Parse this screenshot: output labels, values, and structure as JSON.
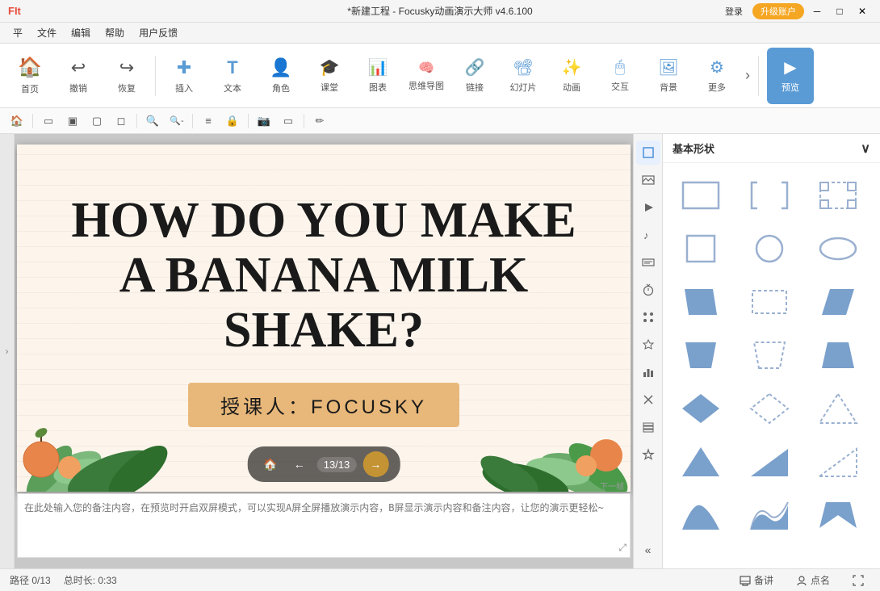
{
  "titlebar": {
    "logo": "FIt",
    "title": "*新建工程 - Focusky动画演示大师 v4.6.100",
    "login_label": "登录",
    "upgrade_label": "升级账户",
    "minimize": "─",
    "maximize": "□",
    "close": "✕"
  },
  "menubar": {
    "items": [
      "平",
      "文件",
      "编辑",
      "帮助",
      "用户反馈"
    ]
  },
  "toolbar": {
    "items": [
      {
        "label": "首页",
        "icon": "🏠"
      },
      {
        "label": "撤销",
        "icon": "↩"
      },
      {
        "label": "恢复",
        "icon": "↪"
      },
      {
        "label": "插入",
        "icon": "➕"
      },
      {
        "label": "文本",
        "icon": "T"
      },
      {
        "label": "角色",
        "icon": "👤"
      },
      {
        "label": "课堂",
        "icon": "🎓"
      },
      {
        "label": "图表",
        "icon": "📊"
      },
      {
        "label": "思维导图",
        "icon": "🔗"
      },
      {
        "label": "链接",
        "icon": "🔗"
      },
      {
        "label": "幻灯片",
        "icon": "📽"
      },
      {
        "label": "动画",
        "icon": "🌟"
      },
      {
        "label": "交互",
        "icon": "🖱"
      },
      {
        "label": "背景",
        "icon": "🖼"
      },
      {
        "label": "更多",
        "icon": "⚙"
      },
      {
        "label": "预览",
        "icon": "▶"
      }
    ]
  },
  "actionbar": {
    "buttons": [
      "🏠",
      "↩",
      "↪",
      "□",
      "□",
      "□",
      "□",
      "🔍+",
      "🔍-",
      "≡",
      "🔒",
      "📷",
      "□",
      "✏"
    ]
  },
  "slide": {
    "title": "HOW DO YOU MAKE\nA BANANA MILK\nSHAKE?",
    "subtitle": "授课人：FOCUSKY",
    "counter": "13/13",
    "next_hint": "下一帧"
  },
  "notes": {
    "placeholder": "在此处输入您的备注内容，在预览时开启双屏模式，可以实现A屏全屏播放演示内容，B屏显示演示内容和备注内容，让您的演示更轻松~"
  },
  "statusbar": {
    "path": "路径 0/13",
    "duration": "总时长: 0:33",
    "backup_label": "备讲",
    "attendance_label": "点名",
    "fullscreen_label": "⛶"
  },
  "shape_panel": {
    "title": "基本形状",
    "shapes": [
      {
        "id": "rect-outline",
        "type": "rect-outline"
      },
      {
        "id": "rect-bracket",
        "type": "rect-bracket"
      },
      {
        "id": "rect-dashed-corner",
        "type": "rect-dashed-corner"
      },
      {
        "id": "rect-solid",
        "type": "rect-solid"
      },
      {
        "id": "circle-outline",
        "type": "circle-outline"
      },
      {
        "id": "oval-outline",
        "type": "oval-outline"
      },
      {
        "id": "parallelogram",
        "type": "parallelogram"
      },
      {
        "id": "rect-dashed",
        "type": "rect-dashed"
      },
      {
        "id": "rect-filled-right",
        "type": "rect-filled-right"
      },
      {
        "id": "trapezoid",
        "type": "trapezoid"
      },
      {
        "id": "trapezoid-dashed",
        "type": "trapezoid-dashed"
      },
      {
        "id": "trapezoid-filled",
        "type": "trapezoid-filled"
      },
      {
        "id": "diamond",
        "type": "diamond"
      },
      {
        "id": "diamond-outline",
        "type": "diamond-outline"
      },
      {
        "id": "triangle-outline",
        "type": "triangle-outline"
      },
      {
        "id": "triangle-filled",
        "type": "triangle-filled"
      },
      {
        "id": "triangle-right",
        "type": "triangle-right"
      },
      {
        "id": "triangle-right-dashed",
        "type": "triangle-right-dashed"
      },
      {
        "id": "hill",
        "type": "hill"
      },
      {
        "id": "wave",
        "type": "wave"
      },
      {
        "id": "pentagon",
        "type": "pentagon"
      }
    ]
  },
  "right_icons": [
    {
      "id": "shapes",
      "icon": "□",
      "active": true
    },
    {
      "id": "image",
      "icon": "🖼"
    },
    {
      "id": "video",
      "icon": "▶"
    },
    {
      "id": "music",
      "icon": "♪"
    },
    {
      "id": "text-box",
      "icon": "≡"
    },
    {
      "id": "timer",
      "icon": "⏱"
    },
    {
      "id": "group",
      "icon": "⁙"
    },
    {
      "id": "animate",
      "icon": "🔄"
    },
    {
      "id": "chart2",
      "icon": "📊"
    },
    {
      "id": "cross",
      "icon": "✕"
    },
    {
      "id": "layers",
      "icon": "📑"
    },
    {
      "id": "star",
      "icon": "★"
    },
    {
      "id": "collapse",
      "icon": "«"
    }
  ]
}
